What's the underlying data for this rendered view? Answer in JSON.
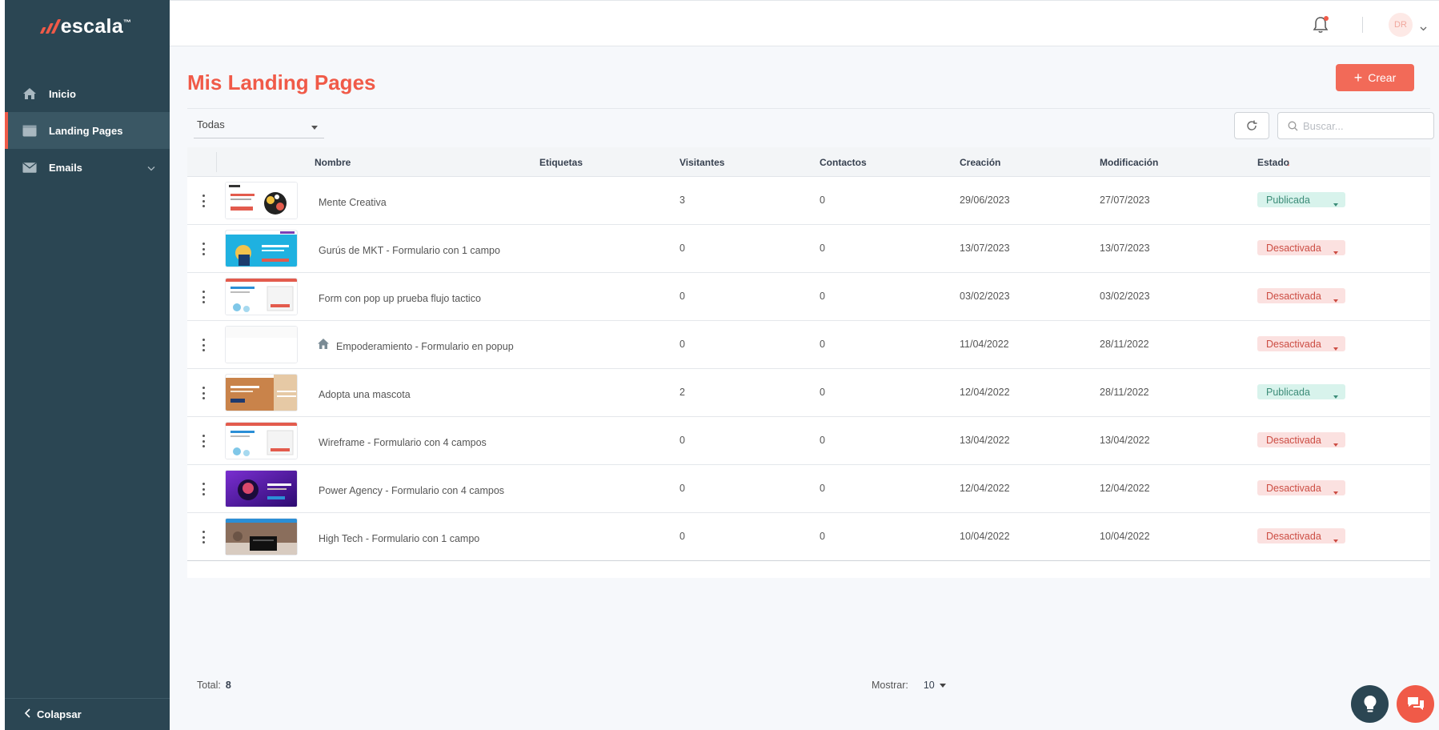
{
  "app": {
    "logo_text": "escala",
    "logo_mark": "™"
  },
  "sidebar": {
    "items": [
      {
        "label": "Inicio",
        "icon": "home-icon"
      },
      {
        "label": "Landing Pages",
        "icon": "browser-window-icon"
      },
      {
        "label": "Emails",
        "icon": "envelope-icon"
      }
    ],
    "collapse_label": "Colapsar"
  },
  "topbar": {
    "avatar_initials": "DR"
  },
  "page": {
    "title": "Mis Landing Pages",
    "create_label": "Crear"
  },
  "toolbar": {
    "filter_value": "Todas",
    "search_placeholder": "Buscar..."
  },
  "table": {
    "headers": [
      "Nombre",
      "Etiquetas",
      "Visitantes",
      "Contactos",
      "Creación",
      "Modificación",
      "Estado"
    ],
    "sort_indicator": "↓",
    "rows": [
      {
        "name": "Mente Creativa",
        "visitors": "3",
        "contacts": "0",
        "created": "29/06/2023",
        "modified": "27/07/2023",
        "status": "Publicada",
        "status_type": "pub",
        "thumb": "creative"
      },
      {
        "name": "Gurús de MKT - Formulario con 1 campo",
        "visitors": "0",
        "contacts": "0",
        "created": "13/07/2023",
        "modified": "13/07/2023",
        "status": "Desactivada",
        "status_type": "off",
        "thumb": "blue"
      },
      {
        "name": "Form con pop up prueba flujo tactico",
        "visitors": "0",
        "contacts": "0",
        "created": "03/02/2023",
        "modified": "03/02/2023",
        "status": "Desactivada",
        "status_type": "off",
        "thumb": "wire"
      },
      {
        "name": "Empoderamiento - Formulario en popup",
        "visitors": "0",
        "contacts": "0",
        "created": "11/04/2022",
        "modified": "28/11/2022",
        "status": "Desactivada",
        "status_type": "off",
        "thumb": "blank"
      },
      {
        "name": "Adopta una mascota",
        "visitors": "2",
        "contacts": "0",
        "created": "12/04/2022",
        "modified": "28/11/2022",
        "status": "Publicada",
        "status_type": "pub",
        "thumb": "pet"
      },
      {
        "name": "Wireframe - Formulario con 4 campos",
        "visitors": "0",
        "contacts": "0",
        "created": "13/04/2022",
        "modified": "13/04/2022",
        "status": "Desactivada",
        "status_type": "off",
        "thumb": "wire"
      },
      {
        "name": "Power Agency - Formulario con 4 campos",
        "visitors": "0",
        "contacts": "0",
        "created": "12/04/2022",
        "modified": "12/04/2022",
        "status": "Desactivada",
        "status_type": "off",
        "thumb": "purple"
      },
      {
        "name": "High Tech - Formulario con 1 campo",
        "visitors": "0",
        "contacts": "0",
        "created": "10/04/2022",
        "modified": "10/04/2022",
        "status": "Desactivada",
        "status_type": "off",
        "thumb": "tech"
      }
    ]
  },
  "footer": {
    "total_label": "Total:",
    "total_value": "8",
    "show_label": "Mostrar:",
    "show_value": "10"
  },
  "colors": {
    "accent": "#f05a48",
    "sidebar": "#2b4653",
    "published_bg": "#d8f3ec",
    "disabled_bg": "#fbe1e0"
  }
}
